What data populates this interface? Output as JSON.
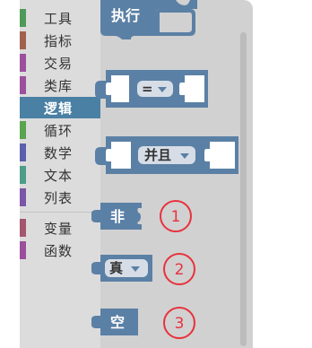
{
  "sidebar": {
    "categories": [
      {
        "label": "工具",
        "color": "#4f9a58"
      },
      {
        "label": "指标",
        "color": "#a0614c"
      },
      {
        "label": "交易",
        "color": "#9c4f9c"
      },
      {
        "label": "类库",
        "color": "#9c4f9c"
      },
      {
        "label": "逻辑",
        "color": "#4a80a4",
        "selected": true
      },
      {
        "label": "循环",
        "color": "#5aa34f"
      },
      {
        "label": "数学",
        "color": "#5b5fae"
      },
      {
        "label": "文本",
        "color": "#4e9c8a"
      },
      {
        "label": "列表",
        "color": "#7a55a8"
      },
      {
        "label": "变量",
        "color": "#a3566e"
      },
      {
        "label": "函数",
        "color": "#9b4e9b"
      }
    ]
  },
  "flyout": {
    "exec_block": {
      "label": "执行",
      "color": "#5b80a5"
    },
    "compare_block": {
      "operator": "=",
      "color": "#5b80a5"
    },
    "logic_op_block": {
      "operator": "并且",
      "color": "#5b80a5"
    },
    "not_block": {
      "label": "非",
      "color": "#5b80a5"
    },
    "boolean_block": {
      "value": "真",
      "color": "#5b80a5"
    },
    "null_block": {
      "label": "空",
      "color": "#5b80a5"
    }
  },
  "annotations": {
    "markers": [
      "1",
      "2",
      "3"
    ],
    "color": "#e8323c"
  }
}
